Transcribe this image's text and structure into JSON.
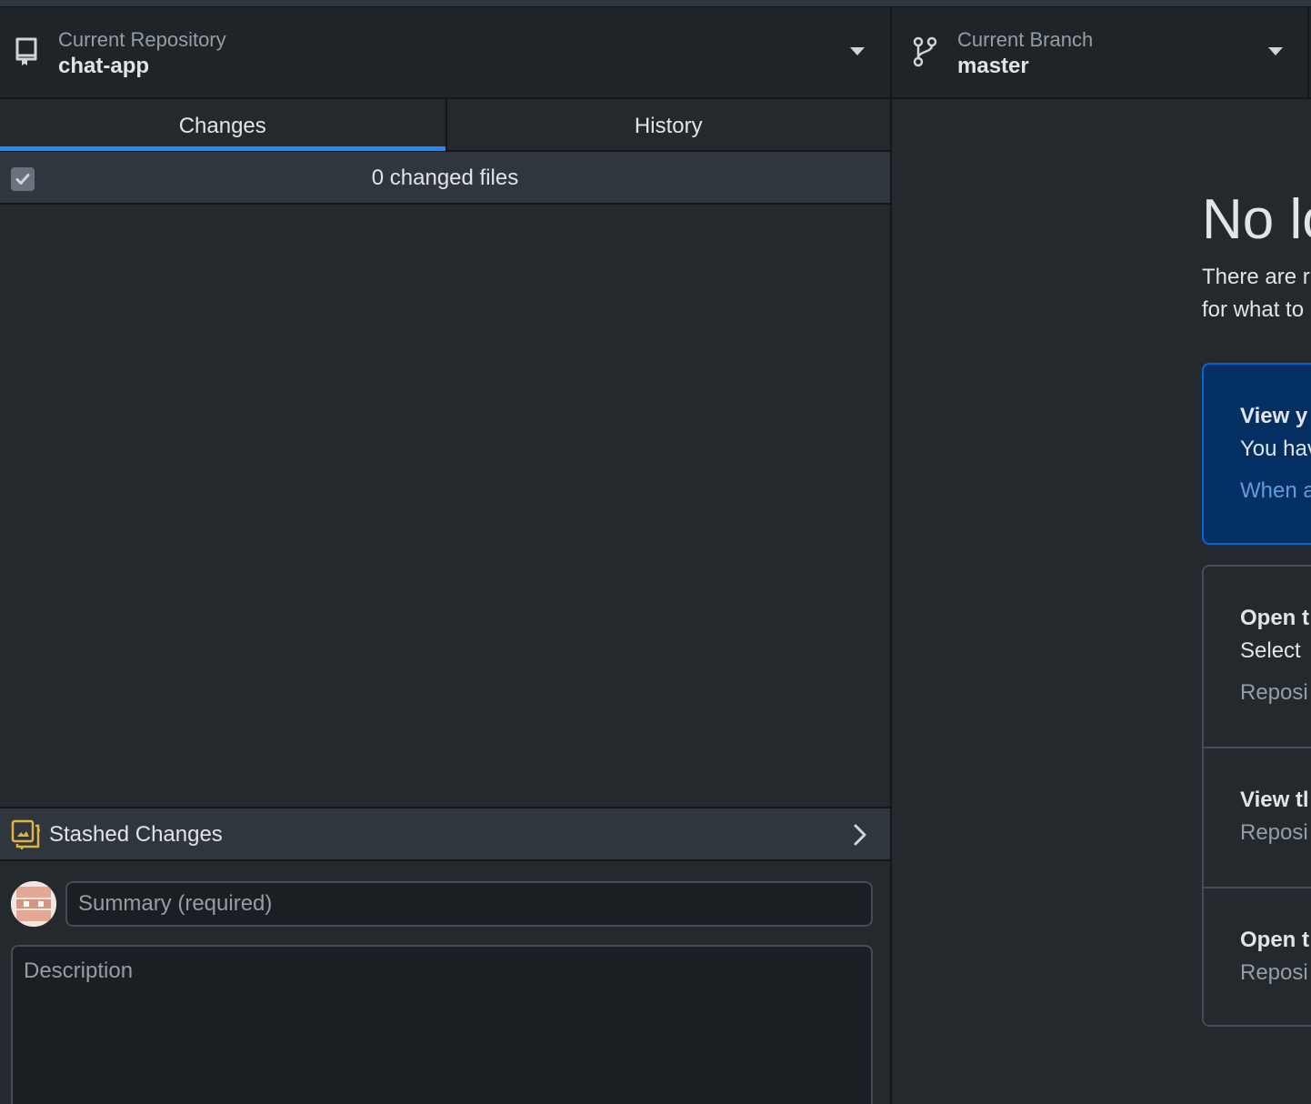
{
  "toolbar": {
    "repository": {
      "label": "Current Repository",
      "value": "chat-app"
    },
    "branch": {
      "label": "Current Branch",
      "value": "master"
    }
  },
  "tabs": [
    {
      "label": "Changes",
      "active": true
    },
    {
      "label": "History",
      "active": false
    }
  ],
  "changes": {
    "count_label": "0 changed files",
    "select_all_checked": true
  },
  "stash": {
    "label": "Stashed Changes"
  },
  "commit": {
    "summary_placeholder": "Summary (required)",
    "description_placeholder": "Description"
  },
  "blank_slate": {
    "title": "No lo",
    "subtitle_line1": "There are r",
    "subtitle_line2": "for what to",
    "cards": [
      {
        "title": "View y",
        "desc": "You hav",
        "meta": "When a"
      },
      {
        "title": "Open t",
        "desc": "Select",
        "meta": "Reposi"
      },
      {
        "title": "View tl",
        "desc": "",
        "meta": "Reposi"
      },
      {
        "title": "Open t",
        "desc": "",
        "meta": "Reposi"
      }
    ]
  },
  "colors": {
    "accent": "#2188ff",
    "stash_icon": "#e3b341"
  }
}
